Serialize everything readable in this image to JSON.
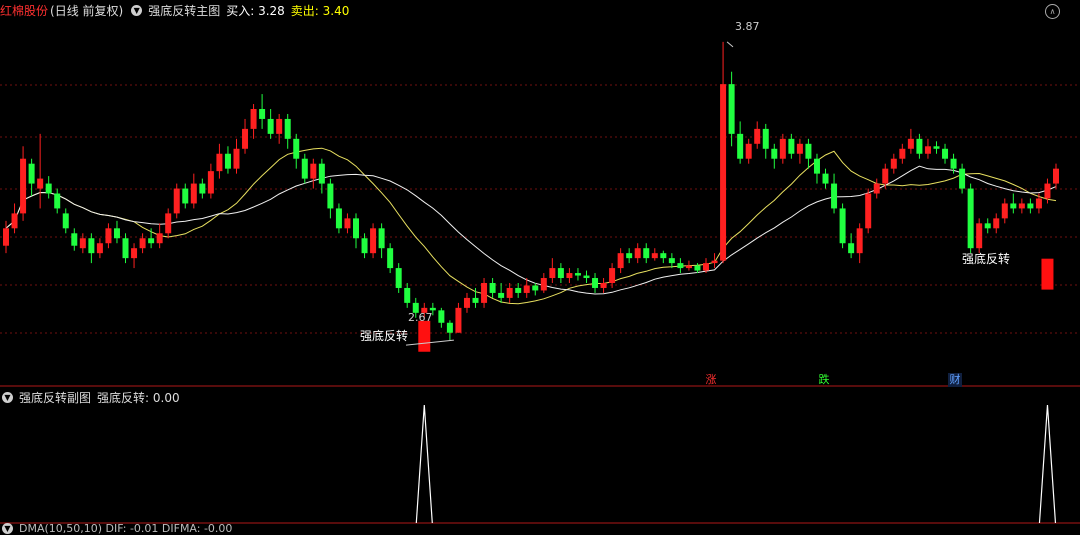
{
  "main_header": {
    "stock_name": "红棉股份",
    "period_label": "(日线 前复权)",
    "indicator_name": "强底反转主图",
    "buy_label": "买入: 3.28",
    "sell_label": "卖出: 3.40",
    "colors": {
      "stock": "#ff3030",
      "buy": "#ffffff",
      "sell": "#ffff00"
    }
  },
  "sub_header": {
    "indicator_name": "强底反转副图",
    "value_label": "强底反转: 0.00"
  },
  "bottom_header": {
    "partial_text": "DMA(10,50,10) DIF: -0.01 DIFMA: -0.00"
  },
  "annotations": {
    "high_price": "3.87",
    "low_price": "2.67",
    "signal_1": "强底反转",
    "signal_2": "强底反转"
  },
  "badges": [
    {
      "label": "涨",
      "color": "#ff3030"
    },
    {
      "label": "跌",
      "color": "#30ff30"
    },
    {
      "label": "财",
      "color": "#60a0ff"
    }
  ],
  "colors": {
    "up": "#ff2020",
    "down": "#20ff40",
    "ma_yellow": "#e8e060",
    "ma_white": "#f0f0f0",
    "grid": "#701010",
    "separator": "#b01818"
  },
  "chart_data": {
    "type": "candlestick",
    "price_range": [
      2.55,
      3.95
    ],
    "candles": [
      [
        3.05,
        3.12,
        3.15,
        3.02
      ],
      [
        3.12,
        3.18,
        3.22,
        3.1
      ],
      [
        3.18,
        3.4,
        3.45,
        3.15
      ],
      [
        3.38,
        3.3,
        3.4,
        3.25
      ],
      [
        3.28,
        3.32,
        3.5,
        3.2
      ],
      [
        3.3,
        3.26,
        3.33,
        3.24
      ],
      [
        3.26,
        3.2,
        3.28,
        3.18
      ],
      [
        3.18,
        3.12,
        3.2,
        3.1
      ],
      [
        3.1,
        3.05,
        3.12,
        3.03
      ],
      [
        3.04,
        3.08,
        3.1,
        3.02
      ],
      [
        3.08,
        3.02,
        3.1,
        2.98
      ],
      [
        3.02,
        3.06,
        3.08,
        3.0
      ],
      [
        3.06,
        3.12,
        3.14,
        3.04
      ],
      [
        3.12,
        3.08,
        3.15,
        3.06
      ],
      [
        3.08,
        3.0,
        3.1,
        2.98
      ],
      [
        3.0,
        3.04,
        3.06,
        2.96
      ],
      [
        3.04,
        3.08,
        3.1,
        3.02
      ],
      [
        3.08,
        3.06,
        3.12,
        3.04
      ],
      [
        3.06,
        3.1,
        3.14,
        3.04
      ],
      [
        3.1,
        3.18,
        3.2,
        3.08
      ],
      [
        3.18,
        3.28,
        3.3,
        3.16
      ],
      [
        3.28,
        3.22,
        3.3,
        3.2
      ],
      [
        3.22,
        3.3,
        3.34,
        3.2
      ],
      [
        3.3,
        3.26,
        3.32,
        3.24
      ],
      [
        3.26,
        3.35,
        3.38,
        3.24
      ],
      [
        3.35,
        3.42,
        3.46,
        3.32
      ],
      [
        3.42,
        3.36,
        3.45,
        3.34
      ],
      [
        3.36,
        3.44,
        3.48,
        3.34
      ],
      [
        3.44,
        3.52,
        3.56,
        3.42
      ],
      [
        3.52,
        3.6,
        3.62,
        3.48
      ],
      [
        3.6,
        3.56,
        3.66,
        3.52
      ],
      [
        3.56,
        3.5,
        3.6,
        3.48
      ],
      [
        3.5,
        3.56,
        3.58,
        3.46
      ],
      [
        3.56,
        3.48,
        3.58,
        3.44
      ],
      [
        3.48,
        3.4,
        3.5,
        3.36
      ],
      [
        3.4,
        3.32,
        3.42,
        3.3
      ],
      [
        3.32,
        3.38,
        3.4,
        3.28
      ],
      [
        3.38,
        3.3,
        3.4,
        3.26
      ],
      [
        3.3,
        3.2,
        3.32,
        3.16
      ],
      [
        3.2,
        3.12,
        3.22,
        3.1
      ],
      [
        3.12,
        3.16,
        3.18,
        3.1
      ],
      [
        3.16,
        3.08,
        3.18,
        3.04
      ],
      [
        3.08,
        3.02,
        3.1,
        3.0
      ],
      [
        3.02,
        3.12,
        3.14,
        3.0
      ],
      [
        3.12,
        3.04,
        3.14,
        3.0
      ],
      [
        3.04,
        2.96,
        3.06,
        2.94
      ],
      [
        2.96,
        2.88,
        2.98,
        2.86
      ],
      [
        2.88,
        2.82,
        2.9,
        2.8
      ],
      [
        2.82,
        2.78,
        2.84,
        2.76
      ],
      [
        2.78,
        2.8,
        2.82,
        2.76
      ],
      [
        2.8,
        2.79,
        2.82,
        2.77
      ],
      [
        2.79,
        2.74,
        2.8,
        2.72
      ],
      [
        2.74,
        2.7,
        2.75,
        2.67
      ],
      [
        2.7,
        2.8,
        2.82,
        2.7
      ],
      [
        2.8,
        2.84,
        2.86,
        2.78
      ],
      [
        2.84,
        2.82,
        2.88,
        2.8
      ],
      [
        2.82,
        2.9,
        2.92,
        2.8
      ],
      [
        2.9,
        2.86,
        2.92,
        2.84
      ],
      [
        2.86,
        2.84,
        2.9,
        2.82
      ],
      [
        2.84,
        2.88,
        2.9,
        2.82
      ],
      [
        2.88,
        2.86,
        2.9,
        2.84
      ],
      [
        2.86,
        2.89,
        2.92,
        2.84
      ],
      [
        2.89,
        2.87,
        2.9,
        2.85
      ],
      [
        2.87,
        2.92,
        2.94,
        2.86
      ],
      [
        2.92,
        2.96,
        3.0,
        2.9
      ],
      [
        2.96,
        2.92,
        2.98,
        2.9
      ],
      [
        2.92,
        2.94,
        2.96,
        2.9
      ],
      [
        2.94,
        2.93,
        2.96,
        2.91
      ],
      [
        2.93,
        2.92,
        2.95,
        2.9
      ],
      [
        2.92,
        2.88,
        2.94,
        2.86
      ],
      [
        2.88,
        2.9,
        2.92,
        2.86
      ],
      [
        2.9,
        2.96,
        2.98,
        2.88
      ],
      [
        2.96,
        3.02,
        3.04,
        2.94
      ],
      [
        3.02,
        3.0,
        3.04,
        2.98
      ],
      [
        3.0,
        3.04,
        3.06,
        2.98
      ],
      [
        3.04,
        3.0,
        3.06,
        2.98
      ],
      [
        3.0,
        3.02,
        3.04,
        2.99
      ],
      [
        3.02,
        3.0,
        3.03,
        2.98
      ],
      [
        3.0,
        2.98,
        3.02,
        2.96
      ],
      [
        2.98,
        2.96,
        3.0,
        2.94
      ],
      [
        2.96,
        2.97,
        2.99,
        2.95
      ],
      [
        2.97,
        2.95,
        2.98,
        2.94
      ],
      [
        2.95,
        2.98,
        3.0,
        2.94
      ],
      [
        2.98,
        2.99,
        3.02,
        2.96
      ],
      [
        2.99,
        3.7,
        3.87,
        2.98
      ],
      [
        3.7,
        3.5,
        3.75,
        3.45
      ],
      [
        3.5,
        3.4,
        3.55,
        3.38
      ],
      [
        3.4,
        3.46,
        3.48,
        3.38
      ],
      [
        3.46,
        3.52,
        3.55,
        3.44
      ],
      [
        3.52,
        3.44,
        3.54,
        3.4
      ],
      [
        3.44,
        3.4,
        3.46,
        3.36
      ],
      [
        3.4,
        3.48,
        3.5,
        3.38
      ],
      [
        3.48,
        3.42,
        3.5,
        3.4
      ],
      [
        3.42,
        3.46,
        3.48,
        3.38
      ],
      [
        3.46,
        3.4,
        3.48,
        3.36
      ],
      [
        3.4,
        3.34,
        3.42,
        3.3
      ],
      [
        3.34,
        3.3,
        3.36,
        3.28
      ],
      [
        3.3,
        3.2,
        3.34,
        3.18
      ],
      [
        3.2,
        3.06,
        3.22,
        3.04
      ],
      [
        3.06,
        3.02,
        3.1,
        3.0
      ],
      [
        3.02,
        3.12,
        3.14,
        2.98
      ],
      [
        3.12,
        3.26,
        3.28,
        3.1
      ],
      [
        3.26,
        3.3,
        3.32,
        3.24
      ],
      [
        3.3,
        3.36,
        3.38,
        3.28
      ],
      [
        3.36,
        3.4,
        3.42,
        3.34
      ],
      [
        3.4,
        3.44,
        3.46,
        3.38
      ],
      [
        3.44,
        3.48,
        3.52,
        3.42
      ],
      [
        3.48,
        3.42,
        3.5,
        3.4
      ],
      [
        3.42,
        3.45,
        3.48,
        3.4
      ],
      [
        3.45,
        3.44,
        3.47,
        3.42
      ],
      [
        3.44,
        3.4,
        3.46,
        3.38
      ],
      [
        3.4,
        3.36,
        3.42,
        3.34
      ],
      [
        3.36,
        3.28,
        3.38,
        3.26
      ],
      [
        3.28,
        3.04,
        3.3,
        3.02
      ],
      [
        3.04,
        3.14,
        3.16,
        3.02
      ],
      [
        3.14,
        3.12,
        3.16,
        3.1
      ],
      [
        3.12,
        3.16,
        3.18,
        3.1
      ],
      [
        3.16,
        3.22,
        3.24,
        3.14
      ],
      [
        3.22,
        3.2,
        3.26,
        3.18
      ],
      [
        3.2,
        3.22,
        3.24,
        3.18
      ],
      [
        3.22,
        3.2,
        3.24,
        3.18
      ],
      [
        3.2,
        3.24,
        3.26,
        3.18
      ],
      [
        3.24,
        3.3,
        3.32,
        3.22
      ],
      [
        3.3,
        3.36,
        3.38,
        3.28
      ]
    ],
    "signal_bars": [
      {
        "index": 49,
        "top": 2.78,
        "bottom": 2.72
      },
      {
        "index": 122,
        "top": 3.03,
        "bottom": 2.97
      }
    ],
    "sub_spikes": [
      49,
      122
    ]
  }
}
